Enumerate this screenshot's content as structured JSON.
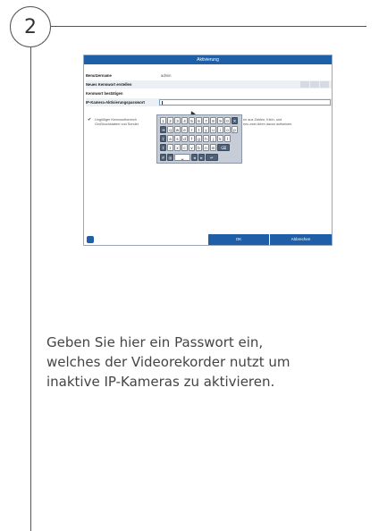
{
  "step": {
    "number": "2"
  },
  "dialog": {
    "title": "Aktivierung",
    "rows": [
      {
        "label": "Benutzername",
        "value": "admin"
      },
      {
        "label": "Neues Kennwort erstellen"
      },
      {
        "label": "Kennwort bestätigen"
      },
      {
        "label": "IP-Kamera-Aktivierungspasswort"
      }
    ],
    "hint": {
      "line1_left": "Ungültiger Kennwortbereich",
      "line2_left": "Großbuchstaben und Sonder",
      "line1_right": "en aus Zahlen, Klein- und",
      "line2_right": "ens zwei Arten davon aufweisen."
    },
    "ok_label": "OK",
    "cancel_label": "Abbrechen"
  },
  "keyboard": {
    "row1": [
      "1",
      "2",
      "3",
      "4",
      "5",
      "6",
      "7",
      "8",
      "9",
      "0"
    ],
    "row2": [
      "q",
      "w",
      "e",
      "r",
      "t",
      "y",
      "u",
      "i",
      "o",
      "p"
    ],
    "row3": [
      "a",
      "s",
      "d",
      "f",
      "g",
      "h",
      "j",
      "k",
      "l"
    ],
    "row4": [
      "z",
      "x",
      "c",
      "v",
      "b",
      "n",
      "m"
    ]
  },
  "caption": {
    "line1": "Geben Sie hier ein Passwort ein,",
    "line2": "welches der Videorekorder nutzt um",
    "line3": "inaktive IP-Kameras zu aktivieren."
  }
}
